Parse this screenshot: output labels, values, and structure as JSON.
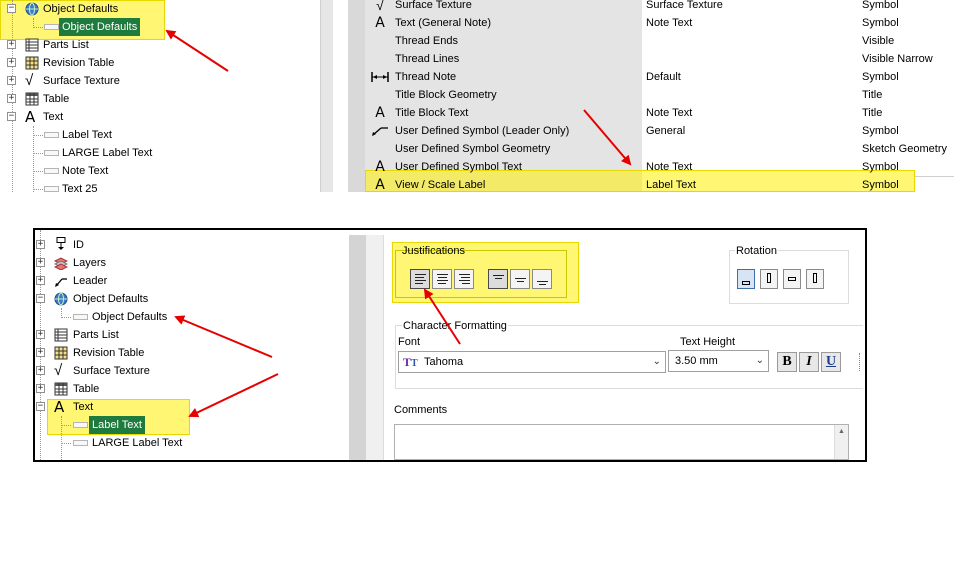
{
  "top_tree": {
    "items": [
      {
        "label": "Object Defaults",
        "icon": "globe-icon"
      },
      {
        "label": "Object Defaults",
        "icon": "rect-icon",
        "selected": true
      },
      {
        "label": "Parts List",
        "icon": "parts-list-icon"
      },
      {
        "label": "Revision Table",
        "icon": "revision-table-icon"
      },
      {
        "label": "Surface Texture",
        "icon": "check-icon"
      },
      {
        "label": "Table",
        "icon": "table-icon"
      },
      {
        "label": "Text",
        "icon": "text-a-icon"
      },
      {
        "label": "Label Text",
        "icon": "rect-icon"
      },
      {
        "label": "LARGE Label Text",
        "icon": "rect-icon"
      },
      {
        "label": "Note Text",
        "icon": "rect-icon"
      },
      {
        "label": "Text 25",
        "icon": "rect-icon"
      }
    ]
  },
  "top_table": {
    "rows": [
      {
        "icon": "check-icon",
        "name": "Surface Texture",
        "style": "Surface Texture",
        "layer": "Symbol"
      },
      {
        "icon": "text-a-icon",
        "name": "Text (General Note)",
        "style": "Note Text",
        "layer": "Symbol"
      },
      {
        "icon": "",
        "name": "Thread Ends",
        "style": "",
        "layer": "Visible"
      },
      {
        "icon": "",
        "name": "Thread Lines",
        "style": "",
        "layer": "Visible Narrow"
      },
      {
        "icon": "thread-note-icon",
        "name": "Thread Note",
        "style": "Default",
        "layer": "Symbol"
      },
      {
        "icon": "",
        "name": "Title Block Geometry",
        "style": "",
        "layer": "Title"
      },
      {
        "icon": "text-a-icon",
        "name": "Title Block Text",
        "style": "Note Text",
        "layer": "Title"
      },
      {
        "icon": "leader-icon",
        "name": "User Defined Symbol (Leader Only)",
        "style": "General",
        "layer": "Symbol"
      },
      {
        "icon": "",
        "name": "User Defined Symbol Geometry",
        "style": "",
        "layer": "Sketch Geometry"
      },
      {
        "icon": "text-a-icon",
        "name": "User Defined Symbol Text",
        "style": "Note Text",
        "layer": "Symbol"
      },
      {
        "icon": "text-a-icon",
        "name": "View / Scale Label",
        "style": "Label Text",
        "layer": "Symbol",
        "highlighted": true
      }
    ]
  },
  "bottom_tree": {
    "items": [
      {
        "label": "ID",
        "icon": "id-icon"
      },
      {
        "label": "Layers",
        "icon": "layers-icon"
      },
      {
        "label": "Leader",
        "icon": "leader-icon"
      },
      {
        "label": "Object Defaults",
        "icon": "globe-icon"
      },
      {
        "label": "Object Defaults",
        "icon": "rect-icon"
      },
      {
        "label": "Parts List",
        "icon": "parts-list-icon"
      },
      {
        "label": "Revision Table",
        "icon": "revision-table-icon"
      },
      {
        "label": "Surface Texture",
        "icon": "check-icon"
      },
      {
        "label": "Table",
        "icon": "table-icon"
      },
      {
        "label": "Text",
        "icon": "text-a-icon"
      },
      {
        "label": "Label Text",
        "icon": "rect-icon",
        "selected": true
      },
      {
        "label": "LARGE Label Text",
        "icon": "rect-icon"
      }
    ]
  },
  "bottom_panel": {
    "justifications_title": "Justifications",
    "rotation_title": "Rotation",
    "char_format_title": "Character Formatting",
    "font_label": "Font",
    "font_value": "Tahoma",
    "height_label": "Text Height",
    "height_value": "3.50 mm",
    "bold": "B",
    "italic": "I",
    "underline": "U",
    "comments_label": "Comments"
  },
  "colors": {
    "highlight": "#fff200",
    "selection": "#1f7a3d",
    "arrow": "#e60000"
  }
}
